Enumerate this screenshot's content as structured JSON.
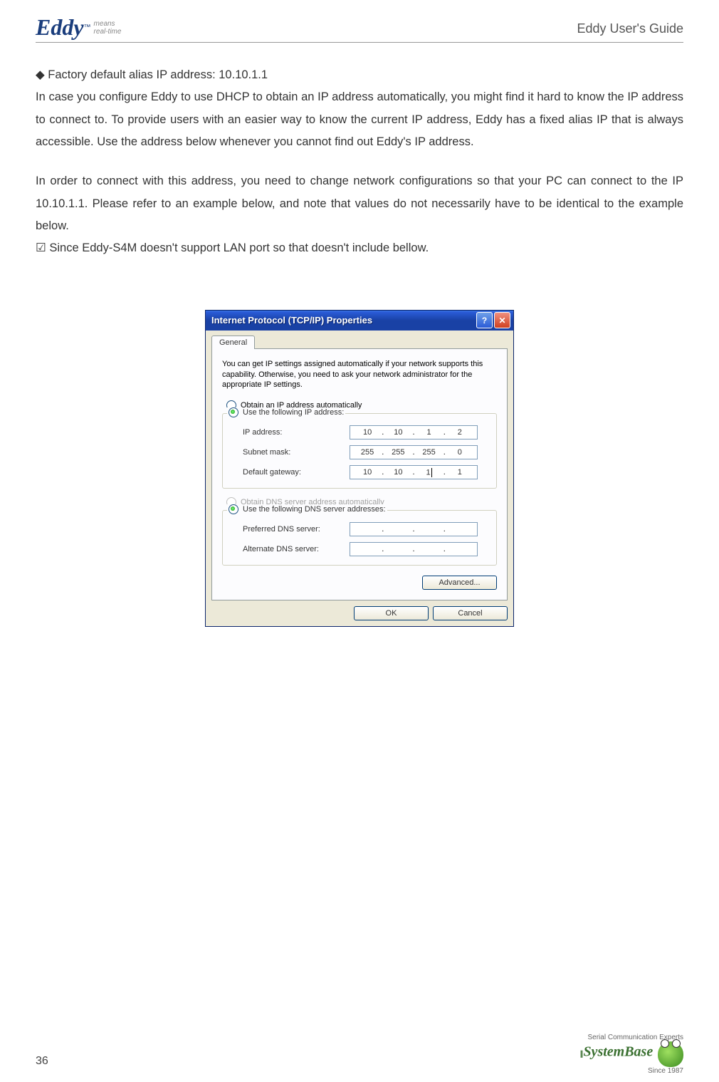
{
  "header": {
    "logo_main": "Eddy",
    "logo_tm": "™",
    "logo_sub1": "means",
    "logo_sub2": "real-time",
    "guide": "Eddy User's Guide"
  },
  "content": {
    "p1": "◆ Factory default alias IP address: 10.10.1.1",
    "p2": "In case you configure Eddy to use DHCP to obtain an IP address automatically, you might find it hard to know the IP address to connect to. To provide users with an easier way to know the current IP address, Eddy has a fixed alias IP that is always accessible. Use the address below whenever you cannot find out Eddy's IP address.",
    "p3": "In order to connect with this address, you need to change network configurations so that your PC can connect to the IP 10.10.1.1. Please refer to an example below, and note that values do not necessarily have to be identical to the example below.",
    "p4": "☑ Since Eddy-S4M doesn't support LAN port so that doesn't include bellow."
  },
  "dialog": {
    "title": "Internet Protocol (TCP/IP) Properties",
    "tab": "General",
    "intro": "You can get IP settings assigned automatically if your network supports this capability. Otherwise, you need to ask your network administrator for the appropriate IP settings.",
    "radio_auto_ip": "Obtain an IP address automatically",
    "radio_use_ip": "Use the following IP address:",
    "label_ip": "IP address:",
    "ip": {
      "a": "10",
      "b": "10",
      "c": "1",
      "d": "2"
    },
    "label_subnet": "Subnet mask:",
    "subnet": {
      "a": "255",
      "b": "255",
      "c": "255",
      "d": "0"
    },
    "label_gateway": "Default gateway:",
    "gateway": {
      "a": "10",
      "b": "10",
      "c": "1",
      "d": "1"
    },
    "radio_auto_dns": "Obtain DNS server address automatically",
    "radio_use_dns": "Use the following DNS server addresses:",
    "label_pref_dns": "Preferred DNS server:",
    "label_alt_dns": "Alternate DNS server:",
    "btn_advanced": "Advanced...",
    "btn_ok": "OK",
    "btn_cancel": "Cancel"
  },
  "footer": {
    "page_num": "36",
    "tagline": "Serial Communication Experts",
    "brand": "SystemBase",
    "since": "Since 1987"
  }
}
